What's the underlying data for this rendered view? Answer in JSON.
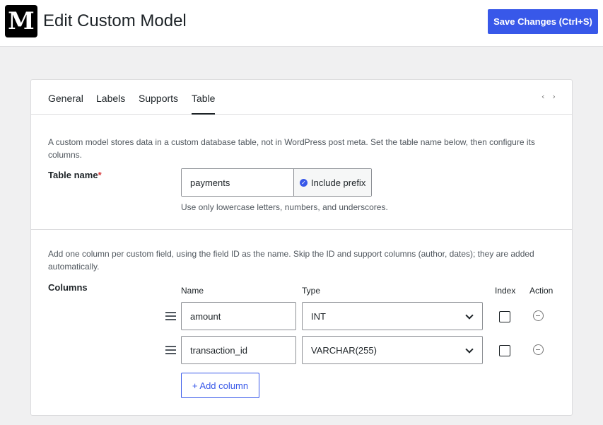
{
  "header": {
    "logo_letter": "M",
    "title": "Edit Custom Model",
    "save_label": "Save Changes (Ctrl+S)"
  },
  "tabs": [
    {
      "label": "General"
    },
    {
      "label": "Labels"
    },
    {
      "label": "Supports"
    },
    {
      "label": "Table",
      "active": true
    }
  ],
  "code_icon_glyph": "‹ ›",
  "table_section": {
    "description": "A custom model stores data in a custom database table, not in WordPress post meta. Set the table name below, then configure its columns.",
    "label": "Table name",
    "required_mark": "*",
    "value": "payments",
    "prefix_label": "Include prefix",
    "help": "Use only lowercase letters, numbers, and underscores."
  },
  "columns_section": {
    "description": "Add one column per custom field, using the field ID as the name. Skip the ID and support columns (author, dates); they are added automatically.",
    "label": "Columns",
    "headers": {
      "name": "Name",
      "type": "Type",
      "index": "Index",
      "action": "Action"
    },
    "rows": [
      {
        "name": "amount",
        "type": "INT",
        "index": false
      },
      {
        "name": "transaction_id",
        "type": "VARCHAR(255)",
        "index": false
      }
    ],
    "add_label": "+ Add column"
  }
}
